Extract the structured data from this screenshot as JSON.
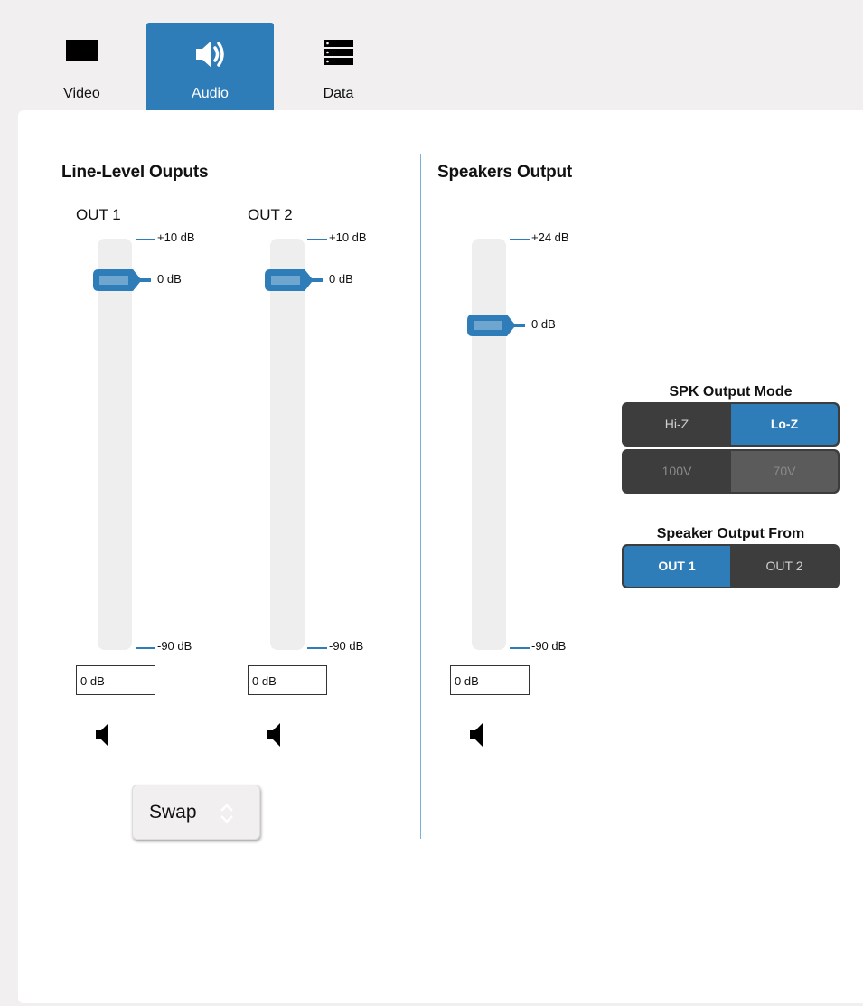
{
  "tabs": [
    {
      "label": "Video",
      "icon": "monitor-icon",
      "active": false
    },
    {
      "label": "Audio",
      "icon": "speaker-icon",
      "active": true
    },
    {
      "label": "Data",
      "icon": "data-list-icon",
      "active": false
    }
  ],
  "line_level": {
    "title": "Line-Level Ouputs",
    "channels": [
      {
        "label": "OUT 1",
        "max_label": "+10 dB",
        "zero_label": "0 dB",
        "min_label": "-90 dB",
        "value": "0 dB",
        "level_db": 0
      },
      {
        "label": "OUT 2",
        "max_label": "+10 dB",
        "zero_label": "0 dB",
        "min_label": "-90 dB",
        "value": "0 dB",
        "level_db": 0
      }
    ],
    "swap_label": "Swap"
  },
  "speakers": {
    "title": "Speakers Output",
    "max_label": "+24 dB",
    "zero_label": "0 dB",
    "min_label": "-90 dB",
    "value": "0 dB",
    "level_db": 0
  },
  "spk_output_mode": {
    "title": "SPK Output Mode",
    "impedance": [
      "Hi-Z",
      "Lo-Z"
    ],
    "impedance_selected": "Lo-Z",
    "voltage": [
      "100V",
      "70V"
    ],
    "voltage_selected": "70V",
    "voltage_enabled": false
  },
  "speaker_output_from": {
    "title": "Speaker Output From",
    "options": [
      "OUT 1",
      "OUT 2"
    ],
    "selected": "OUT 1"
  },
  "colors": {
    "accent": "#2e7db8",
    "segment_dark": "#3d3d3d",
    "background": "#f1efef"
  }
}
